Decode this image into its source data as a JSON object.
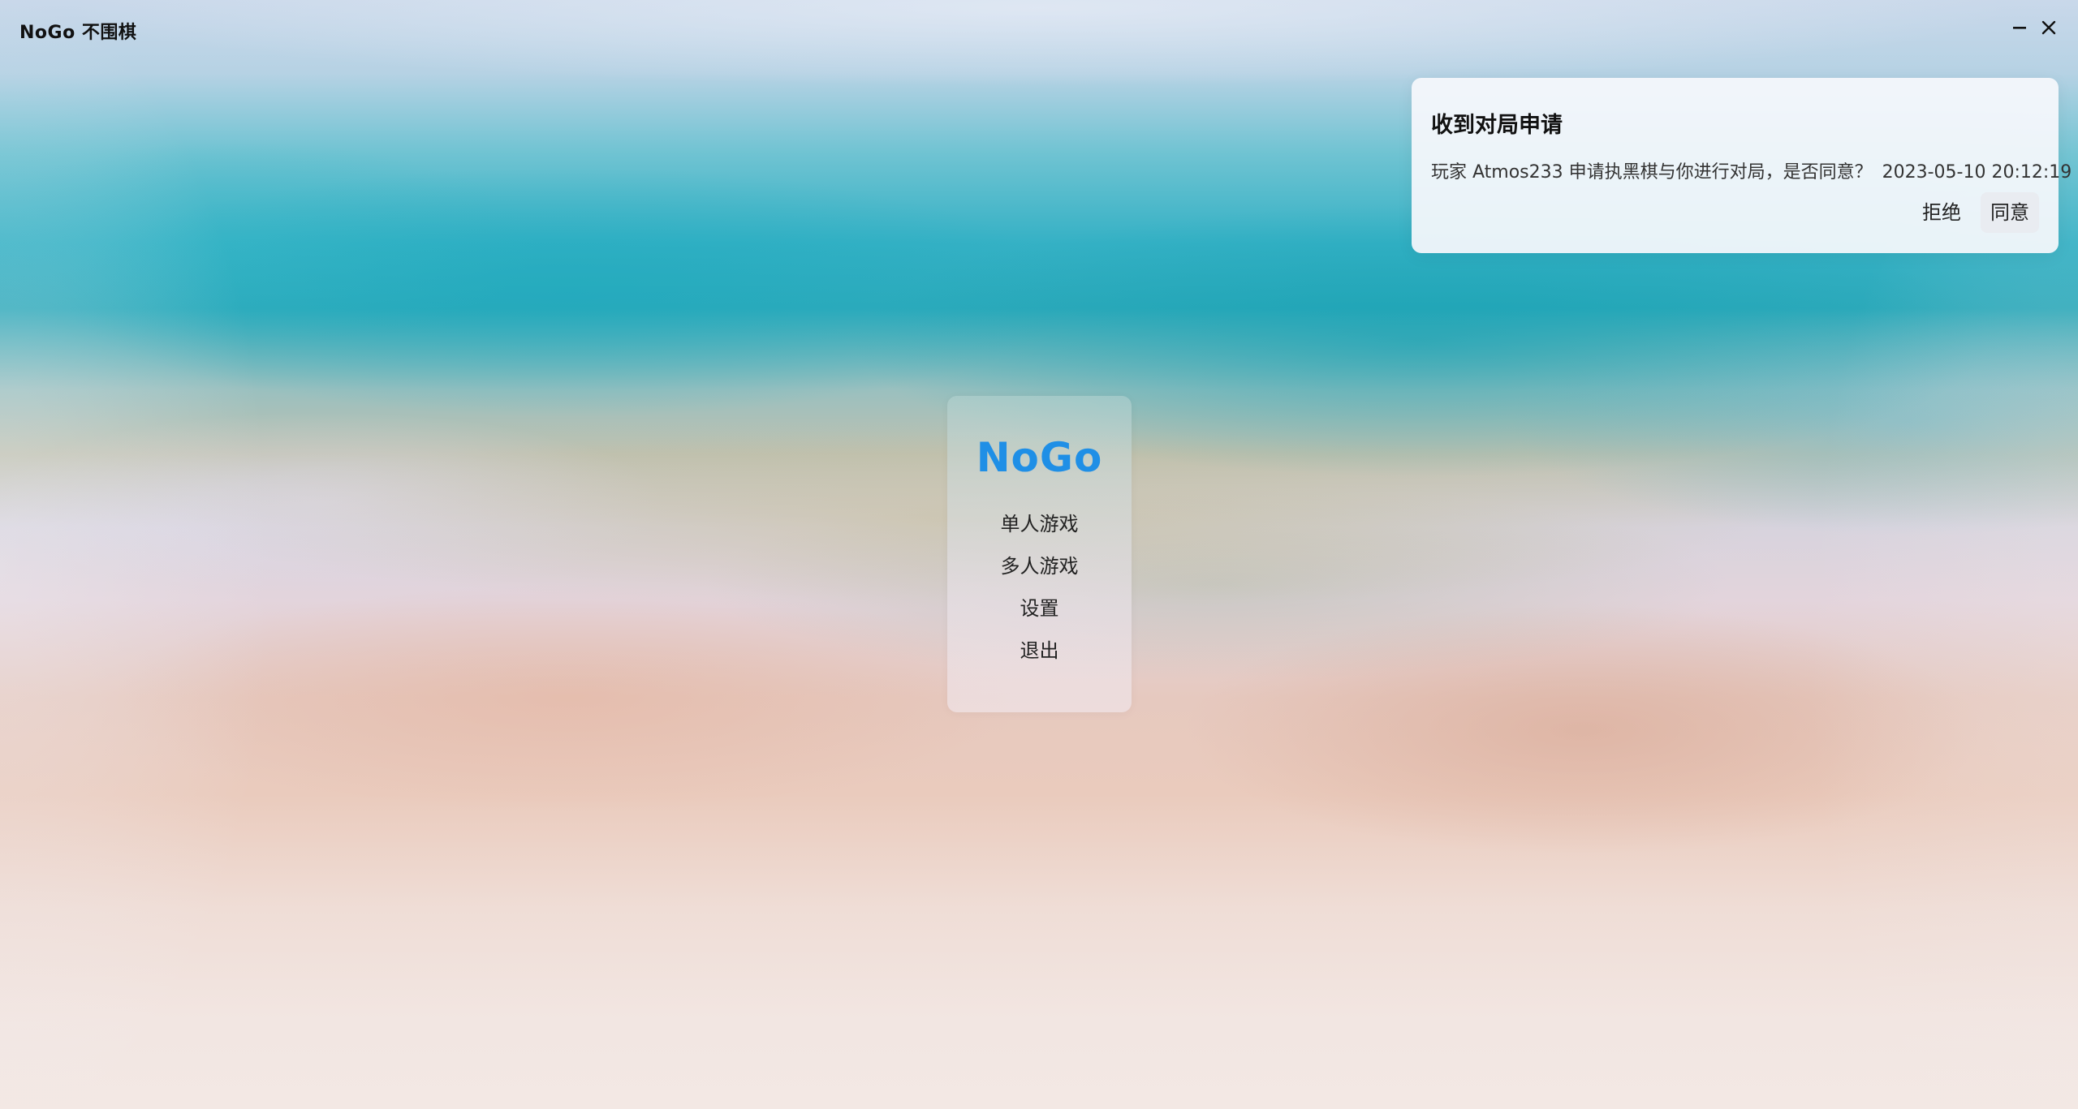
{
  "window": {
    "title": "NoGo 不围棋",
    "controls": {
      "minimize_icon": "minimize-icon",
      "close_icon": "close-icon"
    }
  },
  "menu": {
    "title": "NoGo",
    "title_color": "#1f8fe6",
    "items": [
      {
        "label": "单人游戏"
      },
      {
        "label": "多人游戏"
      },
      {
        "label": "设置"
      },
      {
        "label": "退出"
      }
    ]
  },
  "notification": {
    "title": "收到对局申请",
    "message": "玩家 Atmos233 申请执黑棋与你进行对局，是否同意？",
    "timestamp": "2023-05-10 20:12:19",
    "reject_label": "拒绝",
    "accept_label": "同意"
  }
}
